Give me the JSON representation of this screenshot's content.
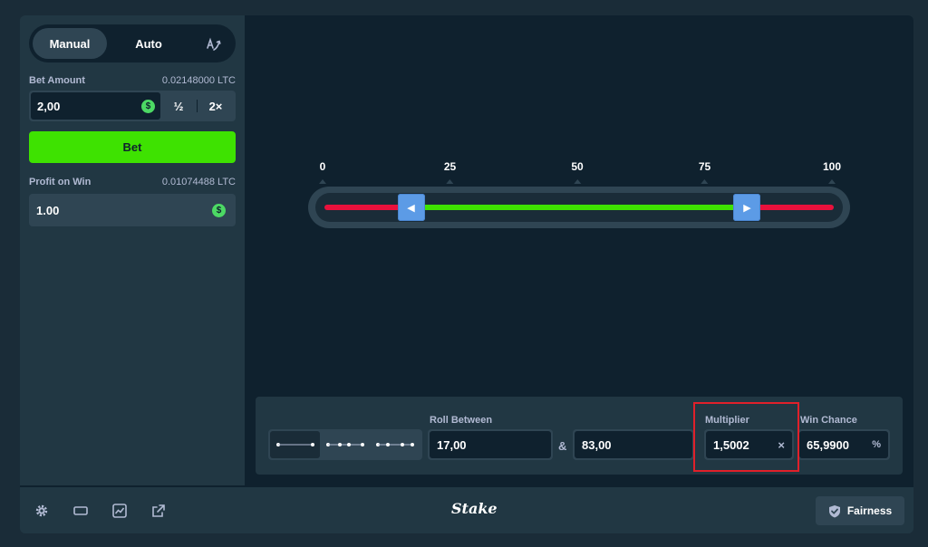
{
  "sidebar": {
    "modes": {
      "manual": "Manual",
      "auto": "Auto"
    },
    "bet_amount": {
      "label": "Bet Amount",
      "crypto_value": "0.02148000 LTC",
      "value": "2,00",
      "currency_icon": "$"
    },
    "half_label": "½",
    "double_label": "2×",
    "bet_button": "Bet",
    "profit": {
      "label": "Profit on Win",
      "crypto_value": "0.01074488 LTC",
      "value": "1.00",
      "currency_icon": "$"
    }
  },
  "slider": {
    "ticks": [
      "0",
      "25",
      "50",
      "75",
      "100"
    ],
    "range_min": 0,
    "range_max": 100,
    "low": 17,
    "high": 83,
    "colors": {
      "win": "#3ee201",
      "lose": "#e9113c",
      "handle": "#5c9be6"
    }
  },
  "controls": {
    "roll_between_label": "Roll Between",
    "roll_low": "17,00",
    "amp": "&",
    "roll_high": "83,00",
    "multiplier_label": "Multiplier",
    "multiplier_value": "1,5002",
    "multiplier_suffix": "×",
    "win_chance_label": "Win Chance",
    "win_chance_value": "65,9900",
    "win_chance_suffix": "%"
  },
  "footer": {
    "brand": "Stake",
    "fairness_label": "Fairness"
  }
}
